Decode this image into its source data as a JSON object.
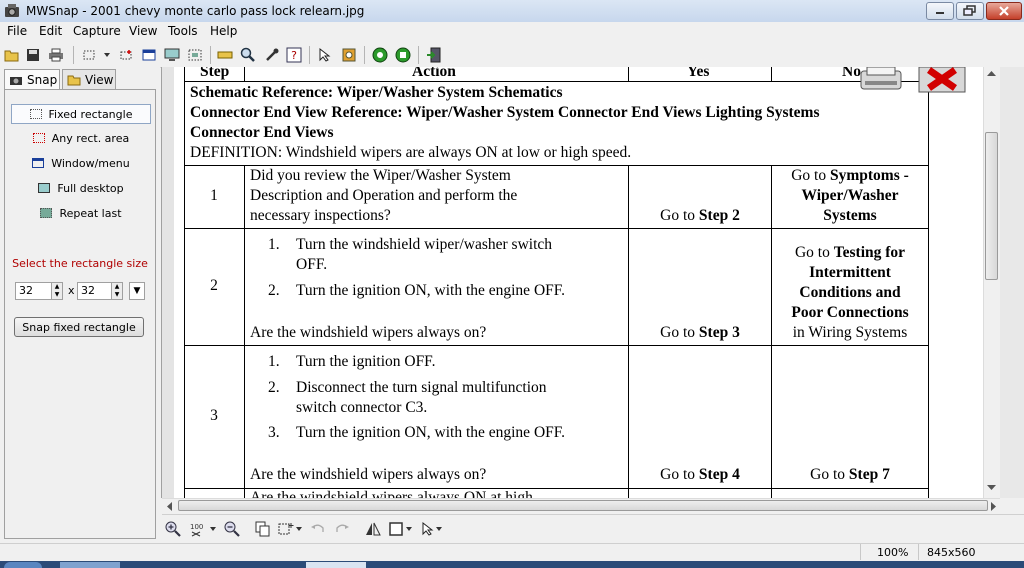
{
  "window": {
    "title": "MWSnap - 2001 chevy monte carlo pass lock relearn.jpg"
  },
  "menu": [
    "File",
    "Edit",
    "Capture",
    "View",
    "Tools",
    "Help"
  ],
  "tabs": {
    "snap": "Snap",
    "view": "View"
  },
  "snap_options": [
    "Fixed rectangle",
    "Any rect. area",
    "Window/menu",
    "Full desktop",
    "Repeat last"
  ],
  "size": {
    "label": "Select the rectangle size",
    "width": "32",
    "height": "32",
    "separator": "x"
  },
  "snap_button": "Snap fixed rectangle",
  "document": {
    "header": {
      "step": "Step",
      "action": "Action",
      "yes": "Yes",
      "no": "No"
    },
    "references": [
      "Schematic Reference: Wiper/Washer System Schematics",
      "Connector End View Reference: Wiper/Washer System Connector End Views Lighting Systems",
      "Connector End Views"
    ],
    "definition": "DEFINITION: Windshield wipers are always ON at low or high speed.",
    "rows": [
      {
        "step": "1",
        "action_lines": [
          "Did you review the Wiper/Washer System",
          "Description and Operation and perform the",
          "necessary inspections?"
        ],
        "yes_prefix": "Go to ",
        "yes_bold": "Step 2",
        "no_prefix": "Go to ",
        "no_bold_1": "Symptoms -",
        "no_bold_2": "Wiper/Washer",
        "no_bold_3": "Systems"
      },
      {
        "step": "2",
        "items": [
          {
            "num": "1.",
            "lines": [
              "Turn the windshield wiper/washer switch",
              "OFF."
            ]
          },
          {
            "num": "2.",
            "lines": [
              "Turn the ignition ON, with the engine OFF."
            ]
          }
        ],
        "question": "Are the windshield wipers always on?",
        "yes_prefix": "Go to ",
        "yes_bold": "Step 3",
        "no_prefix": "Go to ",
        "no_bold_1": "Testing for",
        "no_bold_2": "Intermittent",
        "no_bold_3": "Conditions and",
        "no_bold_4": "Poor Connections",
        "no_tail": "in Wiring Systems"
      },
      {
        "step": "3",
        "items": [
          {
            "num": "1.",
            "lines": [
              "Turn the ignition OFF."
            ]
          },
          {
            "num": "2.",
            "lines": [
              "Disconnect the turn signal multifunction",
              "switch connector C3."
            ]
          },
          {
            "num": "3.",
            "lines": [
              "Turn the ignition ON, with the engine OFF."
            ]
          }
        ],
        "question": "Are the windshield wipers always on?",
        "yes_prefix": "Go to ",
        "yes_bold": "Step 4",
        "no_prefix": "Go to ",
        "no_bold": "Step 7"
      }
    ],
    "partial_row_text": "Are the windshield wipers always ON at high"
  },
  "status": {
    "zoom": "100%",
    "size": "845x560"
  },
  "icons": {
    "toolbar": [
      "open-icon",
      "save-icon",
      "print-icon",
      "fixed-rect-icon",
      "any-rect-icon",
      "window-icon",
      "desktop-icon",
      "repeat-icon",
      "ruler-icon",
      "magnifier-icon",
      "color-picker-icon",
      "help-icon",
      "cursor-icon",
      "settings-icon",
      "record-icon",
      "record2-icon",
      "exit-icon"
    ]
  }
}
